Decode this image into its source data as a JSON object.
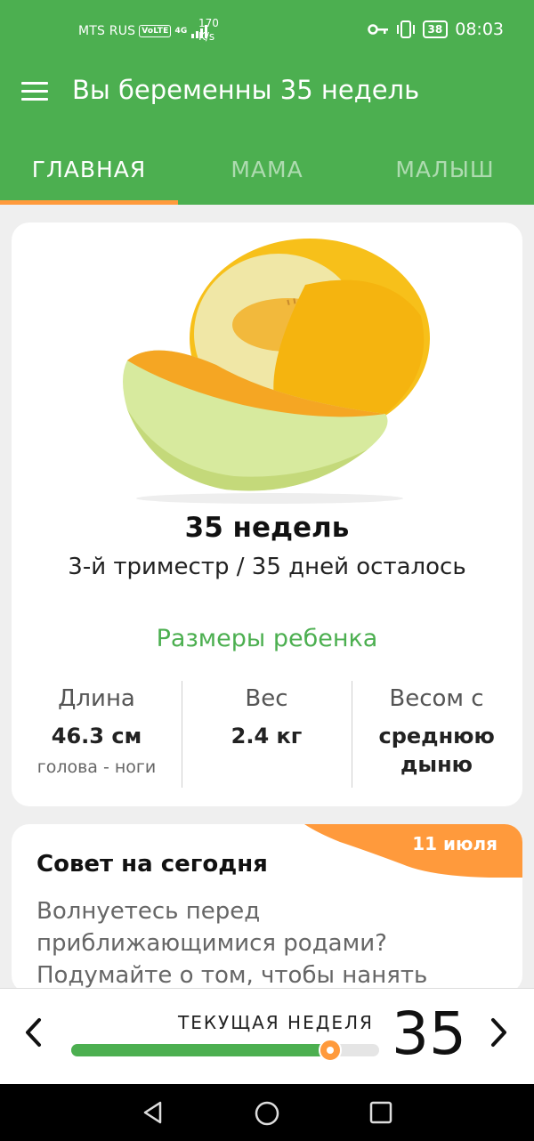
{
  "status": {
    "carrier": "MTS RUS",
    "volte": "VoLTE",
    "network": "4G",
    "speed_value": "170",
    "speed_unit": "K/s",
    "battery": "38",
    "time": "08:03"
  },
  "app": {
    "title": "Вы беременны 35 недель",
    "tabs": [
      {
        "label": "ГЛАВНАЯ",
        "active": true
      },
      {
        "label": "МАМА",
        "active": false
      },
      {
        "label": "МАЛЫШ",
        "active": false
      }
    ]
  },
  "hero": {
    "image": "melon",
    "week_title": "35 недель",
    "week_subtitle": "3-й триместр / 35 дней осталось",
    "sizes_title": "Размеры ребенка",
    "stats": [
      {
        "label": "Длина",
        "value": "46.3 см",
        "note": "голова - ноги"
      },
      {
        "label": "Вес",
        "value": "2.4 кг",
        "note": ""
      },
      {
        "label": "Весом с",
        "value": "среднюю дыню",
        "note": ""
      }
    ]
  },
  "tip": {
    "date": "11 июля",
    "title": "Совет на сегодня",
    "text": "Волнуетесь перед приближающимися родами? Подумайте о том, чтобы нанять"
  },
  "week_selector": {
    "label": "ТЕКУЩАЯ НЕДЕЛЯ",
    "week": "35",
    "progress_fraction": 0.84,
    "prev_icon": "chevron-left-icon",
    "next_icon": "chevron-right-icon"
  },
  "colors": {
    "primary": "#4caf50",
    "accent": "#ff9a3c"
  }
}
